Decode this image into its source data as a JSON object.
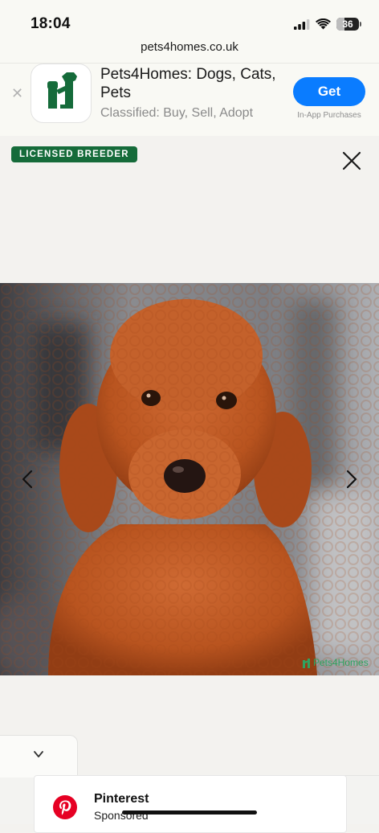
{
  "status": {
    "time": "18:04",
    "battery": "36",
    "battery_level": 0.36,
    "icons": [
      "signal-icon",
      "wifi-icon",
      "battery-icon"
    ]
  },
  "browser": {
    "url": "pets4homes.co.uk"
  },
  "app_banner": {
    "title": "Pets4Homes: Dogs, Cats, Pets",
    "subtitle": "Classified: Buy, Sell, Adopt",
    "get_label": "Get",
    "in_app_label": "In-App Purchases"
  },
  "listing": {
    "badge": "LICENSED BREEDER",
    "watermark": "Pets4Homes"
  },
  "ad": {
    "title": "Pinterest",
    "subtitle": "Sponsored"
  },
  "colors": {
    "accent_blue": "#0a7cff",
    "brand_green": "#156b3a",
    "pinterest_red": "#e60023"
  }
}
